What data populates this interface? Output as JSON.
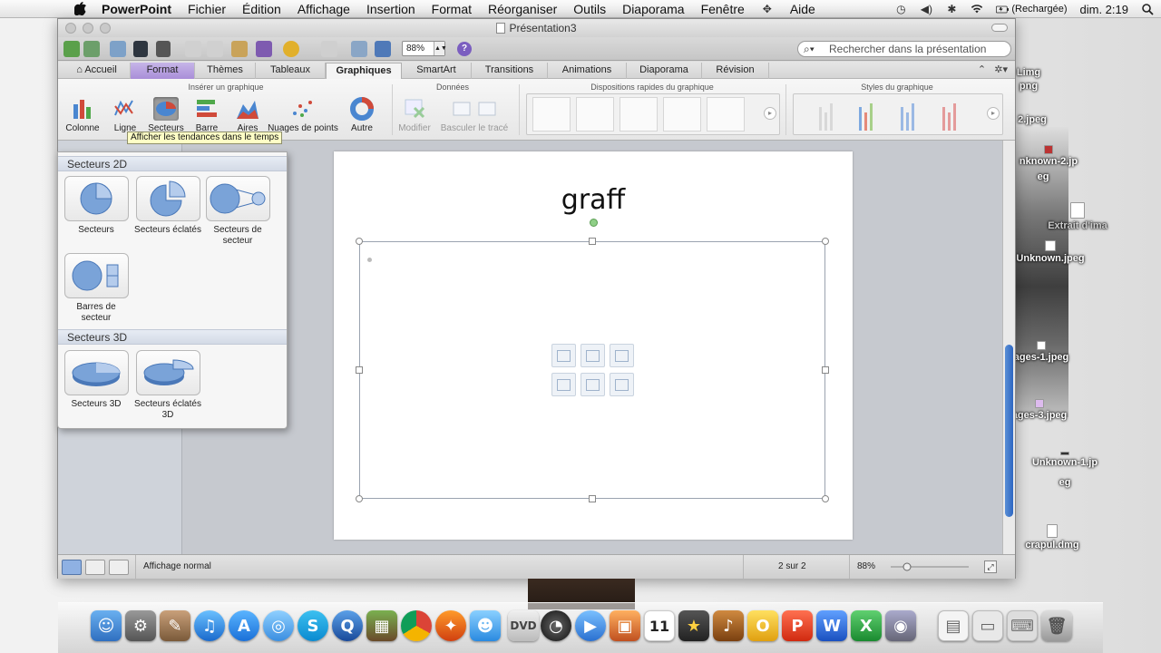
{
  "menubar": {
    "apple": "",
    "app": "PowerPoint",
    "items": [
      "Fichier",
      "Édition",
      "Affichage",
      "Insertion",
      "Format",
      "Réorganiser",
      "Outils",
      "Diaporama",
      "Fenêtre",
      "Aide"
    ],
    "battery": "(Rechargée)",
    "clock": "dim. 2:19"
  },
  "window": {
    "title": "Présentation3",
    "zoom": "88%",
    "search_placeholder": "Rechercher dans la présentation"
  },
  "ribbon_tabs": [
    "Accueil",
    "Format",
    "Thèmes",
    "Tableaux",
    "Graphiques",
    "SmartArt",
    "Transitions",
    "Animations",
    "Diaporama",
    "Révision"
  ],
  "ribbon": {
    "group_insert": "Insérer un graphique",
    "group_data": "Données",
    "group_layouts": "Dispositions rapides du graphique",
    "group_styles": "Styles du graphique",
    "buttons": {
      "colonne": "Colonne",
      "ligne": "Ligne",
      "secteurs": "Secteurs",
      "barre": "Barre",
      "aires": "Aires",
      "nuages": "Nuages de points",
      "autre": "Autre",
      "modifier": "Modifier",
      "basculer": "Basculer le tracé"
    },
    "tooltip": "Afficher les tendances dans le temps"
  },
  "pie_menu": {
    "section_2d": "Secteurs 2D",
    "section_3d": "Secteurs 3D",
    "items_2d": [
      "Secteurs",
      "Secteurs éclatés",
      "Secteurs de secteur",
      "Barres de secteur"
    ],
    "items_3d": [
      "Secteurs 3D",
      "Secteurs éclatés 3D"
    ]
  },
  "slide": {
    "title": "graff"
  },
  "statusbar": {
    "view": "Affichage normal",
    "page": "2 sur 2",
    "zoom": "88%"
  },
  "desktop_icons": [
    "Limg",
    "png",
    "2.jpeg",
    "nknown-2.jp",
    "eg",
    "Extrait d'ima",
    "Unknown.jpeg",
    "ages-1.jpeg",
    "ages-3.jpeg",
    "Unknown-1.jp",
    "eg",
    "crapul.dmg"
  ],
  "colors": {
    "format_tab": "#b39ddf",
    "accent_blue": "#2d66c2",
    "tooltip_bg": "#ffffc6"
  }
}
